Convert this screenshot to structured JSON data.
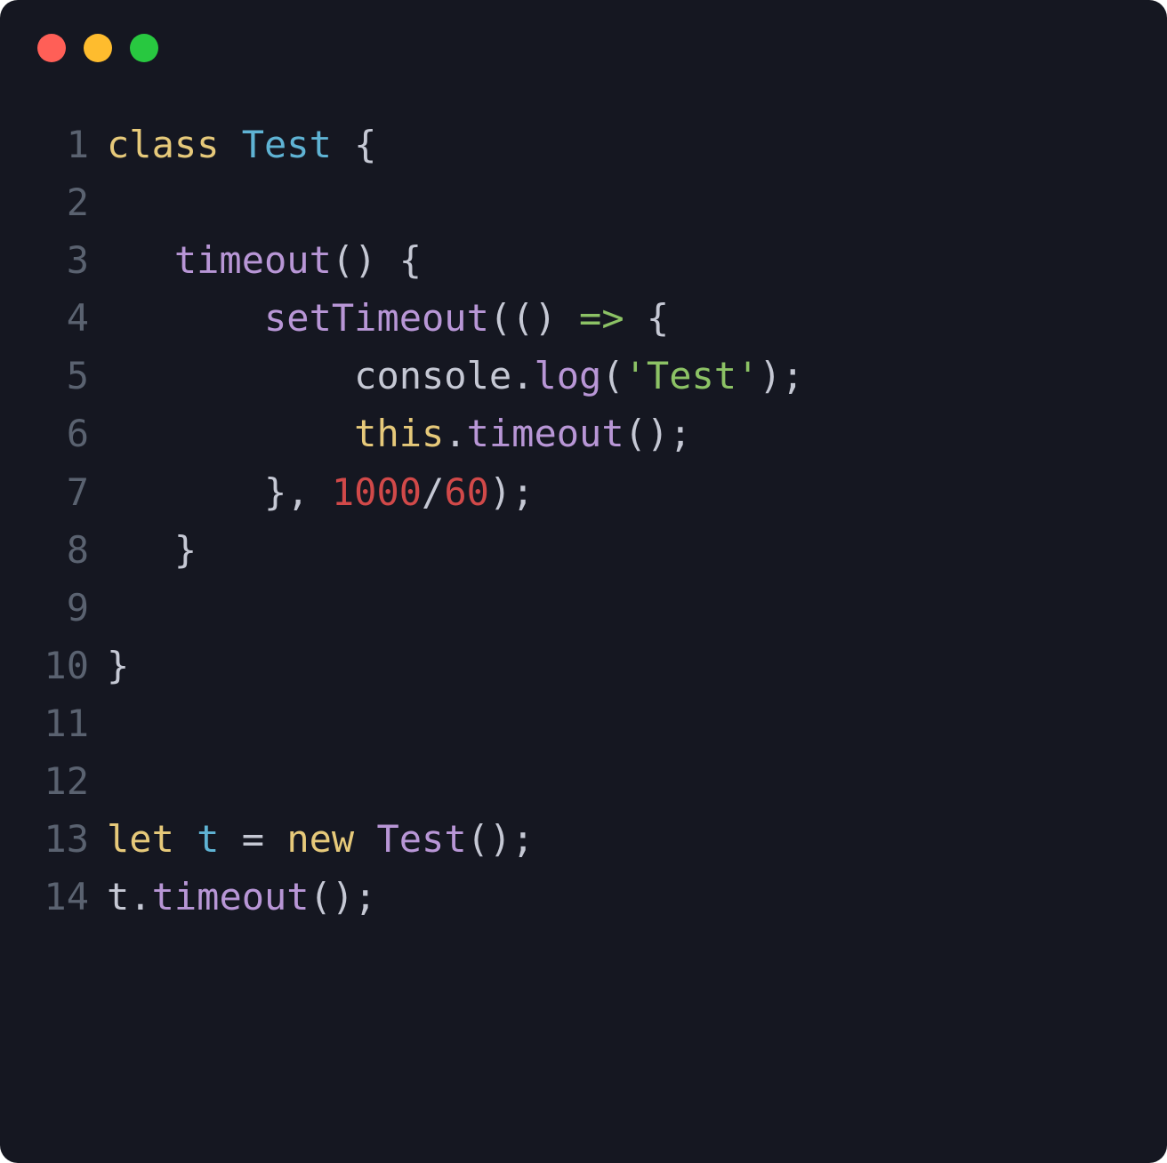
{
  "window": {
    "traffic_lights": [
      "red",
      "yellow",
      "green"
    ]
  },
  "code": {
    "lines": [
      {
        "n": "1",
        "tokens": [
          {
            "t": "class",
            "c": "tok-keyword"
          },
          {
            "t": " ",
            "c": "tok-punct"
          },
          {
            "t": "Test",
            "c": "tok-class"
          },
          {
            "t": " {",
            "c": "tok-punct"
          }
        ]
      },
      {
        "n": "2",
        "tokens": []
      },
      {
        "n": "3",
        "tokens": [
          {
            "t": "   ",
            "c": "tok-punct"
          },
          {
            "t": "timeout",
            "c": "tok-method"
          },
          {
            "t": "() {",
            "c": "tok-punct"
          }
        ]
      },
      {
        "n": "4",
        "tokens": [
          {
            "t": "       ",
            "c": "tok-punct"
          },
          {
            "t": "setTimeout",
            "c": "tok-function"
          },
          {
            "t": "(() ",
            "c": "tok-punct"
          },
          {
            "t": "=>",
            "c": "tok-arrow"
          },
          {
            "t": " {",
            "c": "tok-punct"
          }
        ]
      },
      {
        "n": "5",
        "tokens": [
          {
            "t": "           ",
            "c": "tok-punct"
          },
          {
            "t": "console",
            "c": "tok-property"
          },
          {
            "t": ".",
            "c": "tok-punct"
          },
          {
            "t": "log",
            "c": "tok-function"
          },
          {
            "t": "(",
            "c": "tok-punct"
          },
          {
            "t": "'Test'",
            "c": "tok-string"
          },
          {
            "t": ");",
            "c": "tok-punct"
          }
        ]
      },
      {
        "n": "6",
        "tokens": [
          {
            "t": "           ",
            "c": "tok-punct"
          },
          {
            "t": "this",
            "c": "tok-this"
          },
          {
            "t": ".",
            "c": "tok-punct"
          },
          {
            "t": "timeout",
            "c": "tok-function"
          },
          {
            "t": "();",
            "c": "tok-punct"
          }
        ]
      },
      {
        "n": "7",
        "tokens": [
          {
            "t": "       }, ",
            "c": "tok-punct"
          },
          {
            "t": "1000",
            "c": "tok-number"
          },
          {
            "t": "/",
            "c": "tok-punct"
          },
          {
            "t": "60",
            "c": "tok-number"
          },
          {
            "t": ");",
            "c": "tok-punct"
          }
        ]
      },
      {
        "n": "8",
        "tokens": [
          {
            "t": "   }",
            "c": "tok-punct"
          }
        ]
      },
      {
        "n": "9",
        "tokens": []
      },
      {
        "n": "10",
        "tokens": [
          {
            "t": "}",
            "c": "tok-punct"
          }
        ]
      },
      {
        "n": "11",
        "tokens": []
      },
      {
        "n": "12",
        "tokens": []
      },
      {
        "n": "13",
        "tokens": [
          {
            "t": "let",
            "c": "tok-keyword"
          },
          {
            "t": " ",
            "c": "tok-punct"
          },
          {
            "t": "t",
            "c": "tok-var"
          },
          {
            "t": " = ",
            "c": "tok-punct"
          },
          {
            "t": "new",
            "c": "tok-keyword"
          },
          {
            "t": " ",
            "c": "tok-punct"
          },
          {
            "t": "Test",
            "c": "tok-function"
          },
          {
            "t": "();",
            "c": "tok-punct"
          }
        ]
      },
      {
        "n": "14",
        "tokens": [
          {
            "t": "t",
            "c": "tok-property"
          },
          {
            "t": ".",
            "c": "tok-punct"
          },
          {
            "t": "timeout",
            "c": "tok-function"
          },
          {
            "t": "();",
            "c": "tok-punct"
          }
        ]
      }
    ]
  }
}
